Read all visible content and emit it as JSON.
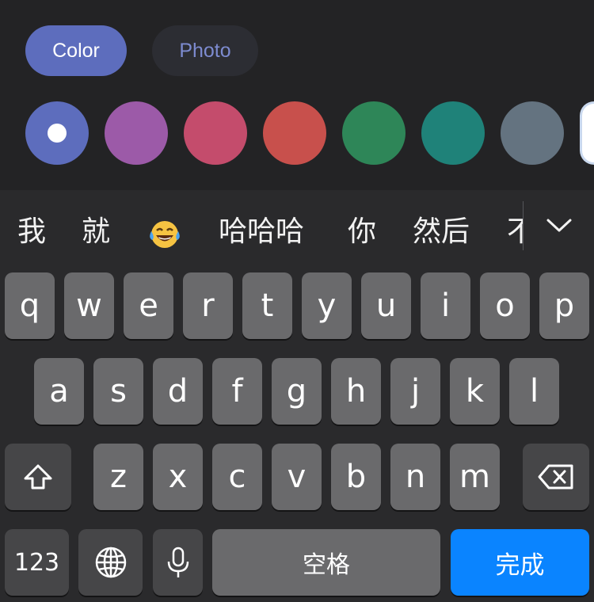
{
  "segments": {
    "color": "Color",
    "photo": "Photo"
  },
  "swatches": [
    "#5d6dbd",
    "#9c5aa8",
    "#c44c6c",
    "#c8504c",
    "#2e8658",
    "#1f8279",
    "#647380",
    "#ffffff"
  ],
  "candidates": [
    "我",
    "就",
    "😂",
    "哈哈哈",
    "你",
    "然后",
    "不"
  ],
  "keyboard": {
    "row1": [
      "q",
      "w",
      "e",
      "r",
      "t",
      "y",
      "u",
      "i",
      "o",
      "p"
    ],
    "row2": [
      "a",
      "s",
      "d",
      "f",
      "g",
      "h",
      "j",
      "k",
      "l"
    ],
    "row3": [
      "z",
      "x",
      "c",
      "v",
      "b",
      "n",
      "m"
    ],
    "numbers_key": "123",
    "space_key": "空格",
    "done_key": "完成",
    "shift_icon": "shift-icon",
    "delete_icon": "delete-icon",
    "globe_icon": "globe-icon",
    "mic_icon": "microphone-icon",
    "collapse_icon": "chevron-down-icon"
  }
}
